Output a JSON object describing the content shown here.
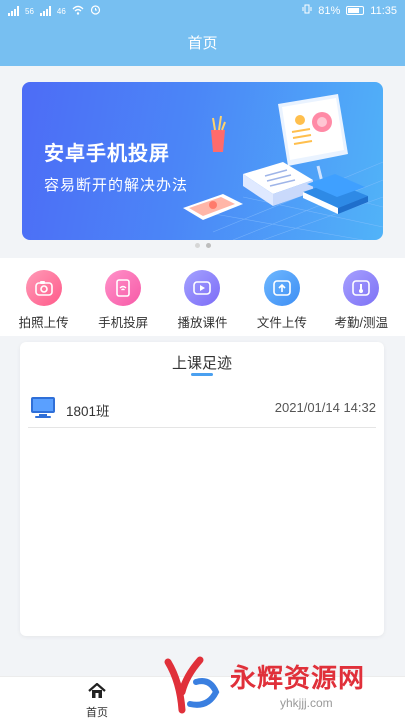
{
  "status_bar": {
    "carrier_left": "56",
    "carrier_right": "46",
    "battery": "81%",
    "time": "11:35"
  },
  "header": {
    "title": "首页"
  },
  "banner": {
    "headline": "安卓手机投屏",
    "subline": "容易断开的解决办法",
    "pages": 2,
    "active_page": 2
  },
  "actions": [
    {
      "label": "拍照上传",
      "icon": "camera-icon",
      "color_from": "#ff9bb7",
      "color_to": "#ff5a8a"
    },
    {
      "label": "手机投屏",
      "icon": "phone-cast-icon",
      "color_from": "#ff92c9",
      "color_to": "#f75aa7"
    },
    {
      "label": "播放课件",
      "icon": "play-icon",
      "color_from": "#a4a2ff",
      "color_to": "#7c6cf7"
    },
    {
      "label": "文件上传",
      "icon": "upload-icon",
      "color_from": "#6fb8ff",
      "color_to": "#3d8ef4"
    },
    {
      "label": "考勤/测温",
      "icon": "thermometer-icon",
      "color_from": "#a7a0ff",
      "color_to": "#7d71f5"
    }
  ],
  "footprints": {
    "title": "上课足迹",
    "accent": "#4aa0f0",
    "items": [
      {
        "class_name": "1801班",
        "time": "2021/01/14 14:32"
      }
    ]
  },
  "bottom_nav": {
    "home_label": "首页"
  },
  "watermark": {
    "text": "永辉资源网",
    "url": "yhkjjj.com"
  }
}
